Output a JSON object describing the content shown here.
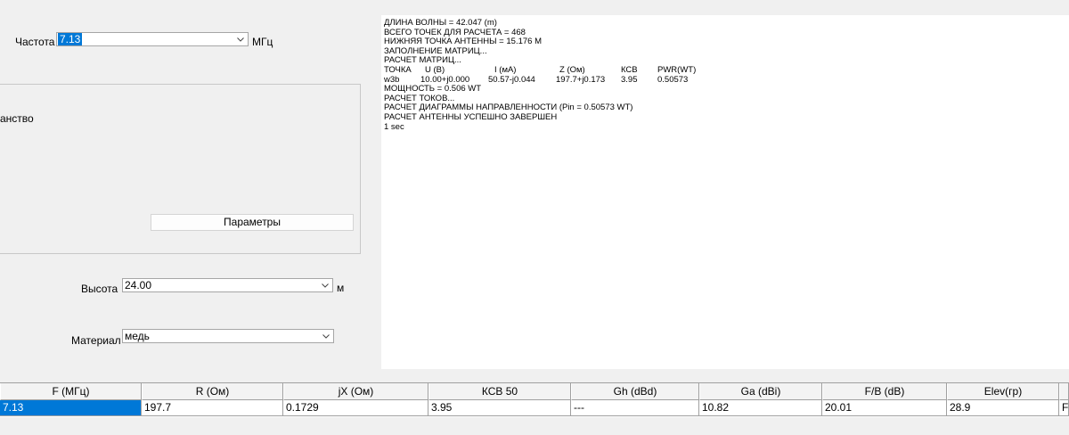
{
  "form": {
    "frequency_label": "Частота",
    "frequency_value": "7.13",
    "frequency_unit": "МГц",
    "group_label_fragment": "анство",
    "params_button": "Параметры",
    "height_label": "Высота",
    "height_value": "24.00",
    "height_unit": "м",
    "material_label": "Материал",
    "material_value": "медь"
  },
  "log": {
    "lines_top": [
      "ДЛИНА ВОЛНЫ = 42.047 (m)",
      "ВСЕГО ТОЧЕК ДЛЯ РАСЧЕТА = 468",
      "НИЖНЯЯ ТОЧКА АНТЕННЫ = 15.176 M",
      "ЗАПОЛНЕНИЕ МАТРИЦ...",
      "РАСЧЕТ МАТРИЦ..."
    ],
    "table_header": [
      "ТОЧКА",
      "U (В)",
      "I (мА)",
      "Z (Ом)",
      "КСВ",
      "PWR(WT)"
    ],
    "table_row": [
      "w3b",
      "10.00+j0.000",
      "50.57-j0.044",
      "197.7+j0.173",
      "3.95",
      "0.50573"
    ],
    "lines_bottom": [
      "МОЩНОСТЬ = 0.506  WT",
      "РАСЧЕТ ТОКОВ...",
      "РАСЧЕТ ДИАГРАММЫ НАПРАВЛЕННОСТИ (Pin = 0.50573 WT)",
      "РАСЧЕТ АНТЕННЫ УСПЕШНО ЗАВЕРШЕН",
      "1 sec"
    ]
  },
  "grid": {
    "headers": [
      "F (МГц)",
      "R (Ом)",
      "jX (Ом)",
      "КСВ 50",
      "Gh (dBd)",
      "Ga (dBi)",
      "F/B (dB)",
      "Elev(гр)",
      ""
    ],
    "row": [
      "7.13",
      "197.7",
      "0.1729",
      "3.95",
      "---",
      "10.82",
      "20.01",
      "28.9",
      "F"
    ]
  },
  "icons": {
    "dropdown": "chevron-down-icon"
  },
  "colors": {
    "selection": "#0078d7",
    "window_bg": "#f0f0f0"
  }
}
